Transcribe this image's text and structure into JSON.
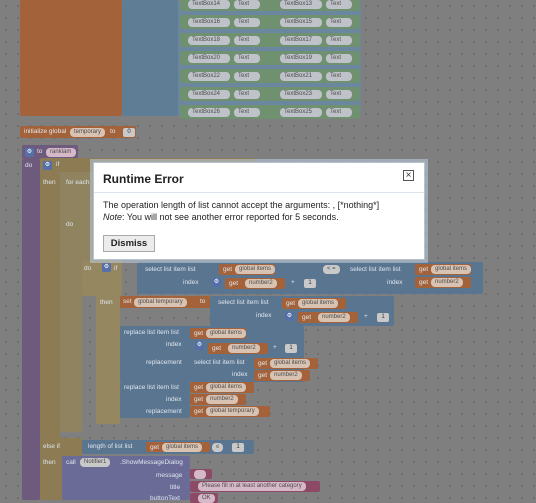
{
  "textbox_rows": [
    {
      "a": "TextBox14",
      "b": "Text",
      "c": "TextBox13",
      "d": "Text"
    },
    {
      "a": "TextBox16",
      "b": "Text",
      "c": "TextBox15",
      "d": "Text"
    },
    {
      "a": "TextBox18",
      "b": "Text",
      "c": "TextBox17",
      "d": "Text"
    },
    {
      "a": "TextBox20",
      "b": "Text",
      "c": "TextBox19",
      "d": "Text"
    },
    {
      "a": "TextBox22",
      "b": "Text",
      "c": "TextBox21",
      "d": "Text"
    },
    {
      "a": "TextBox24",
      "b": "Text",
      "c": "TextBox23",
      "d": "Text"
    },
    {
      "a": "TextBox26",
      "b": "Text",
      "c": "TextBox25",
      "d": "Text"
    }
  ],
  "init": {
    "label": "initialize global",
    "name": "temporary",
    "to": "to",
    "value": "0"
  },
  "proc": {
    "to": "to",
    "name": "ranklam",
    "do": "do"
  },
  "if1": {
    "if": "if",
    "then": "then",
    "foreach": "for each",
    "do": "do"
  },
  "if2": {
    "do": "do",
    "if": "if"
  },
  "cmp": {
    "sel1": "select list item list",
    "get": "get",
    "items": "global items",
    "index": "index",
    "get2": "get",
    "num2": "number2",
    "plus": "+",
    "one": "1",
    "op": "< ="
  },
  "set": {
    "then": "then",
    "set": "set",
    "var": "global temporary",
    "to": "to",
    "sel": "select list item list",
    "items": "global items",
    "index": "index",
    "num2": "number2",
    "plus": "+",
    "one": "1"
  },
  "rep1": {
    "label": "replace list item list",
    "items": "global items",
    "index": "index",
    "num2": "number2",
    "plus": "+",
    "one": "1",
    "replacement": "replacement",
    "sel": "select list item list",
    "index2": "index"
  },
  "rep2": {
    "label": "replace list item list",
    "items": "global items",
    "index": "index",
    "num2": "number2",
    "replacement": "replacement",
    "temp": "global temporary"
  },
  "elseif": {
    "label": "else if",
    "len": "length of list list",
    "get": "get",
    "items": "global items",
    "op": "≤",
    "one": "1"
  },
  "call": {
    "then": "then",
    "call": "call",
    "comp": "Notifier1",
    "method": ".ShowMessageDialog",
    "message": "message",
    "title": "title",
    "titleval": "Please fill in at least another category",
    "buttontext": "buttonText",
    "ok": "OK"
  },
  "dialog": {
    "title": "Runtime Error",
    "message": "The operation length of list cannot accept the arguments: , [*nothing*]",
    "note_label": "Note",
    "note_text": ": You will not see another error reported for 5 seconds.",
    "dismiss": "Dismiss",
    "close": "×"
  },
  "colors": {
    "procedure": "#6e5a7d",
    "list": "#5f7e95",
    "control": "#8c7b53",
    "variable": "#a4623a"
  }
}
